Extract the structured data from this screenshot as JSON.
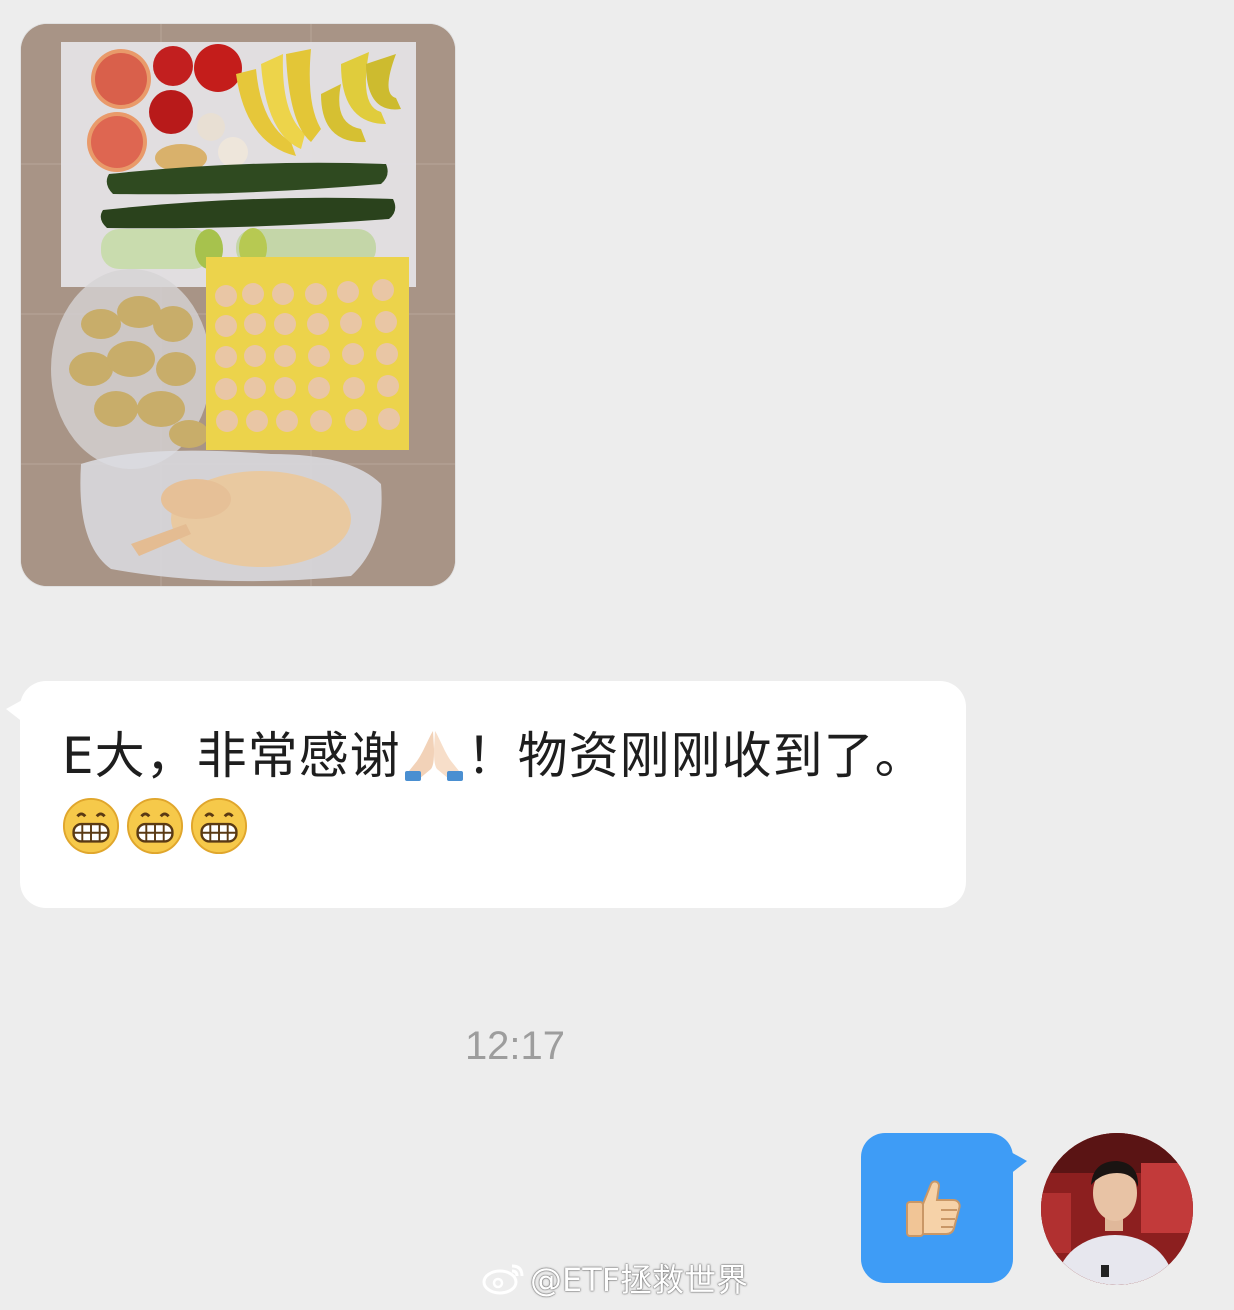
{
  "messages": {
    "incoming_photo": {
      "icon": "groceries-photo"
    },
    "incoming_text": {
      "part1": "E大，非常感谢",
      "emoji_pray": "pray-emoji",
      "part2": "！物资刚刚收到了。",
      "emoji_grin": "grin-emoji"
    },
    "timestamp": "12:17",
    "outgoing": {
      "emoji": "thumbs-up-emoji",
      "bubble_color": "#3e9cf6"
    }
  },
  "avatar": {
    "icon": "user-avatar"
  },
  "watermark": {
    "text": "@ETF拯救世界",
    "icon": "weibo-logo"
  }
}
